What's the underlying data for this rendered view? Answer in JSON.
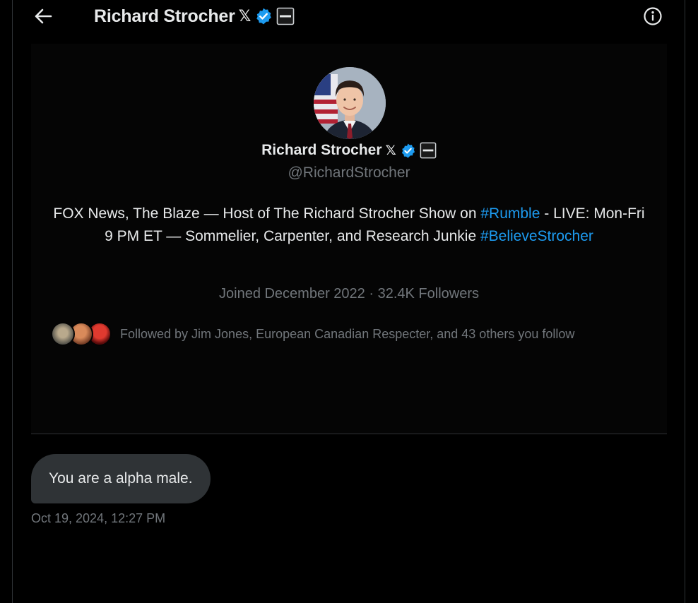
{
  "header": {
    "name": "Richard Strocher",
    "x_glyph": "𝕏"
  },
  "icons": {
    "back": "back-arrow-icon",
    "verified": "verified-badge-icon",
    "affiliate": "affiliate-badge-icon",
    "info": "info-icon"
  },
  "colors": {
    "accent": "#1d9bf0",
    "muted": "#71767b",
    "bubble": "#2f3336"
  },
  "profile": {
    "name": "Richard Strocher",
    "x_glyph": "𝕏",
    "handle": "@RichardStrocher",
    "bio": {
      "part1": "FOX News, The Blaze — Host of The Richard Strocher Show on ",
      "tag1": "#Rumble",
      "part2": " - LIVE: Mon-Fri 9 PM ET — Sommelier, Carpenter, and Research Junkie ",
      "tag2": "#BelieveStrocher"
    },
    "joined": "Joined December 2022",
    "separator": "·",
    "followers": "32.4K Followers",
    "followed_by": "Followed by Jim Jones, European Canadian Respecter, and 43 others you follow"
  },
  "message": {
    "text": "You are a alpha male.",
    "timestamp": "Oct 19, 2024, 12:27 PM"
  }
}
